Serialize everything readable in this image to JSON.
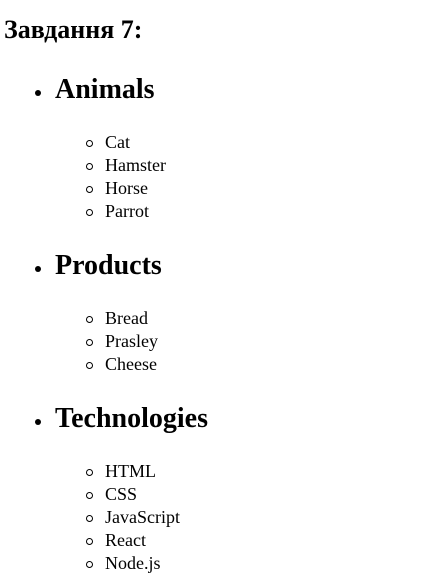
{
  "heading": "Завдання 7:",
  "categories": [
    {
      "title": "Animals",
      "items": [
        "Cat",
        "Hamster",
        "Horse",
        "Parrot"
      ]
    },
    {
      "title": "Products",
      "items": [
        "Bread",
        "Prasley",
        "Cheese"
      ]
    },
    {
      "title": "Technologies",
      "items": [
        "HTML",
        "CSS",
        "JavaScript",
        "React",
        "Node.js"
      ]
    }
  ]
}
